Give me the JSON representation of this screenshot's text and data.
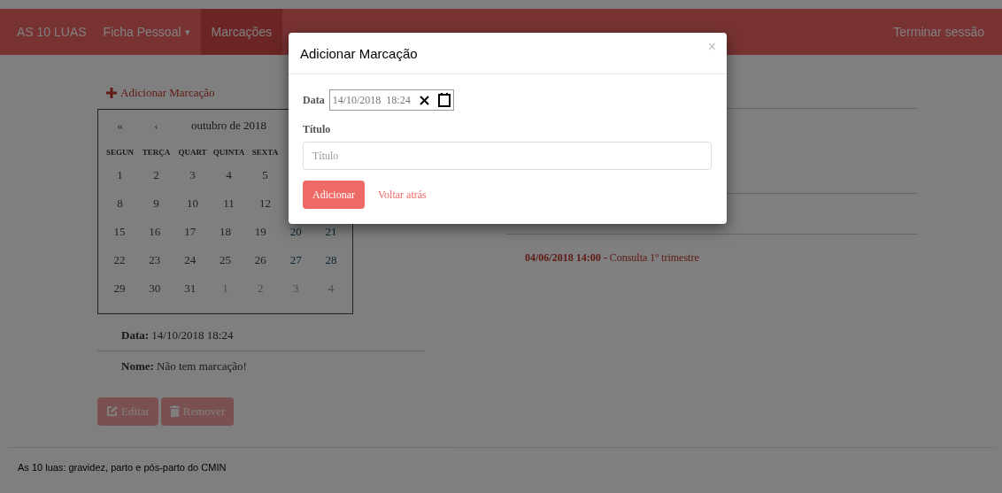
{
  "navbar": {
    "brand": "AS 10 LUAS",
    "items": [
      {
        "label": "Ficha Pessoal",
        "caret": "▾",
        "selected": false
      },
      {
        "label": "Marcações",
        "selected": true
      }
    ],
    "logout": "Terminar sessão"
  },
  "add_link": "Adicionar Marcação",
  "calendar": {
    "nav": [
      "«",
      "‹"
    ],
    "month": "outubro de 2018",
    "weekdays": [
      "SEGUN",
      "TERÇA",
      "QUART",
      "QUINTA",
      "SEXTA"
    ],
    "weeks": [
      [
        {
          "day": "1",
          "other": false,
          "weekend": false,
          "selected": false
        },
        {
          "day": "2",
          "other": false,
          "weekend": false,
          "selected": false
        },
        {
          "day": "3",
          "other": false,
          "weekend": false,
          "selected": false
        },
        {
          "day": "4",
          "other": false,
          "weekend": false,
          "selected": false
        },
        {
          "day": "5",
          "other": false,
          "weekend": false,
          "selected": false
        }
      ],
      [
        {
          "day": "8",
          "other": false,
          "weekend": false,
          "selected": false
        },
        {
          "day": "9",
          "other": false,
          "weekend": false,
          "selected": false
        },
        {
          "day": "10",
          "other": false,
          "weekend": false,
          "selected": false
        },
        {
          "day": "11",
          "other": false,
          "weekend": false,
          "selected": false
        },
        {
          "day": "12",
          "other": false,
          "weekend": false,
          "selected": false
        }
      ],
      [
        {
          "day": "15",
          "other": false,
          "weekend": false,
          "selected": false
        },
        {
          "day": "16",
          "other": false,
          "weekend": false,
          "selected": false
        },
        {
          "day": "17",
          "other": false,
          "weekend": false,
          "selected": false
        },
        {
          "day": "18",
          "other": false,
          "weekend": false,
          "selected": false
        },
        {
          "day": "19",
          "other": false,
          "weekend": false,
          "selected": false
        },
        {
          "day": "20",
          "other": false,
          "weekend": true,
          "selected": false
        },
        {
          "day": "21",
          "other": false,
          "weekend": true,
          "selected": false
        }
      ],
      [
        {
          "day": "22",
          "other": false,
          "weekend": false,
          "selected": false
        },
        {
          "day": "23",
          "other": false,
          "weekend": false,
          "selected": false
        },
        {
          "day": "24",
          "other": false,
          "weekend": false,
          "selected": false
        },
        {
          "day": "25",
          "other": false,
          "weekend": false,
          "selected": false
        },
        {
          "day": "26",
          "other": false,
          "weekend": false,
          "selected": false
        },
        {
          "day": "27",
          "other": false,
          "weekend": true,
          "selected": false
        },
        {
          "day": "28",
          "other": false,
          "weekend": true,
          "selected": false
        }
      ],
      [
        {
          "day": "29",
          "other": false,
          "weekend": false,
          "selected": false
        },
        {
          "day": "30",
          "other": false,
          "weekend": false,
          "selected": false
        },
        {
          "day": "31",
          "other": false,
          "weekend": false,
          "selected": false
        },
        {
          "day": "1",
          "other": true,
          "selected": false
        },
        {
          "day": "2",
          "other": true,
          "selected": false
        },
        {
          "day": "3",
          "other": true,
          "selected": false
        },
        {
          "day": "4",
          "other": true,
          "selected": false
        }
      ]
    ]
  },
  "details": [
    {
      "label": "Data:",
      "value": "14/10/2018 18:24"
    },
    {
      "label": "Nome:",
      "value": "Não tem marcação!"
    }
  ],
  "actions": [
    {
      "kind": "edit",
      "label": "Editar"
    },
    {
      "kind": "remove",
      "label": "Remover"
    }
  ],
  "appointments": [
    {
      "date": "04/06/2018 14:00",
      "separator": "-",
      "title": "Consulta 1º trimestre"
    }
  ],
  "footer": "As 10 luas: gravidez, parto e pós-parto do CMIN",
  "modal": {
    "title": "Adicionar Marcação",
    "close": "×",
    "date_label": "Data",
    "date_value": "14/10/2018  18:24",
    "title_label": "Título",
    "title_placeholder": "Título",
    "submit": "Adicionar",
    "back": "Voltar atrás"
  }
}
